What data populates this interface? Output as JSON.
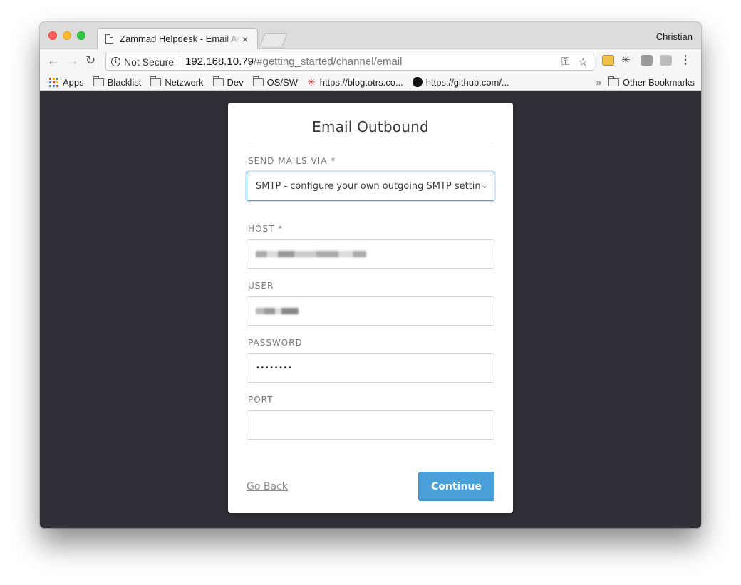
{
  "browser": {
    "profile_name": "Christian",
    "tab_title": "Zammad Helpdesk - Email Acc",
    "tab_close": "×",
    "security_label": "Not Secure",
    "url_host": "192.168.10.79",
    "url_path": "/#getting_started/channel/email"
  },
  "bookmarks": {
    "items": [
      {
        "label": "Apps",
        "icon": "apps-grid-icon"
      },
      {
        "label": "Blacklist",
        "icon": "folder-icon"
      },
      {
        "label": "Netzwerk",
        "icon": "folder-icon"
      },
      {
        "label": "Dev",
        "icon": "folder-icon"
      },
      {
        "label": "OS/SW",
        "icon": "folder-icon"
      },
      {
        "label": "https://blog.otrs.co...",
        "icon": "otrs-icon"
      },
      {
        "label": "https://github.com/...",
        "icon": "github-icon"
      }
    ],
    "overflow": "»",
    "other": "Other Bookmarks"
  },
  "form": {
    "title": "Email Outbound",
    "send_via_label": "SEND MAILS VIA *",
    "send_via_value": "SMTP - configure your own outgoing SMTP settings",
    "host_label": "HOST *",
    "user_label": "USER",
    "password_label": "PASSWORD",
    "password_value": "••••••••",
    "port_label": "PORT",
    "port_value": "",
    "back_label": "Go Back",
    "continue_label": "Continue"
  },
  "colors": {
    "accent": "#4aa0d8",
    "background": "#2f3038"
  }
}
